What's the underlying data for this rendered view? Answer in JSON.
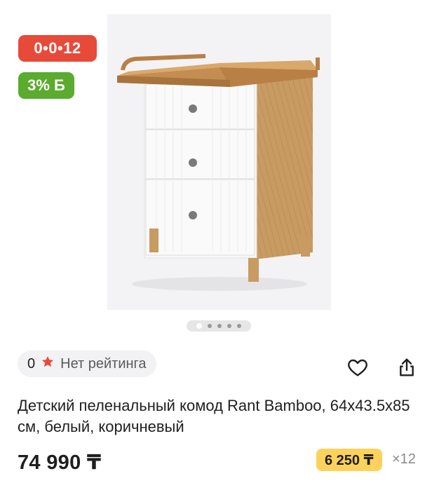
{
  "badges": {
    "installment": "0•0•12",
    "bonus": "3% Б"
  },
  "gallery": {
    "image_count": 5,
    "active_index": 0
  },
  "rating": {
    "count": "0",
    "label": "Нет рейтинга"
  },
  "actions": {
    "favorite_icon": "heart-icon",
    "share_icon": "share-icon"
  },
  "product": {
    "title": "Детский пеленальный комод Rant Bamboo, 64x43.5x85 см, белый, коричневый",
    "price": "74 990 ₸",
    "monthly_payment": "6 250 ₸",
    "months": "×12"
  },
  "colors": {
    "installment_badge": "#e84a3a",
    "bonus_badge": "#5aab2e",
    "monthly_badge": "#fcd25c",
    "star": "#e84a3a"
  }
}
